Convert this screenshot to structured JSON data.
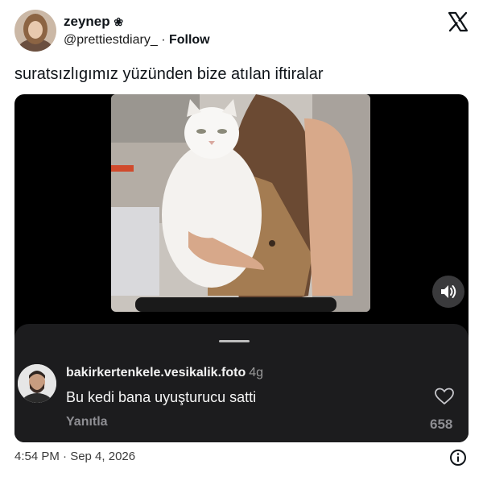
{
  "tweet": {
    "display_name": "zeynep",
    "display_name_emoji": "❀",
    "handle": "@prettiestdiary_",
    "separator": "·",
    "follow_label": "Follow",
    "text": "suratsızlıgımız yüzünden bize atılan iftiralar",
    "timestamp": "4:54 PM · Sep 4, 2026"
  },
  "icons": {
    "brand": "x-logo-icon",
    "sound": "speaker-icon",
    "like": "heart-icon",
    "info": "info-icon"
  },
  "comment": {
    "username": "bakirkertenkele.vesikalik.foto",
    "age": "4g",
    "text": "Bu kedi bana uyuşturucu satti",
    "reply_label": "Yanıtla",
    "likes": "658"
  },
  "colors": {
    "media_bg": "#000000",
    "panel_bg": "#1c1c1e",
    "muted": "#8e8e93"
  }
}
